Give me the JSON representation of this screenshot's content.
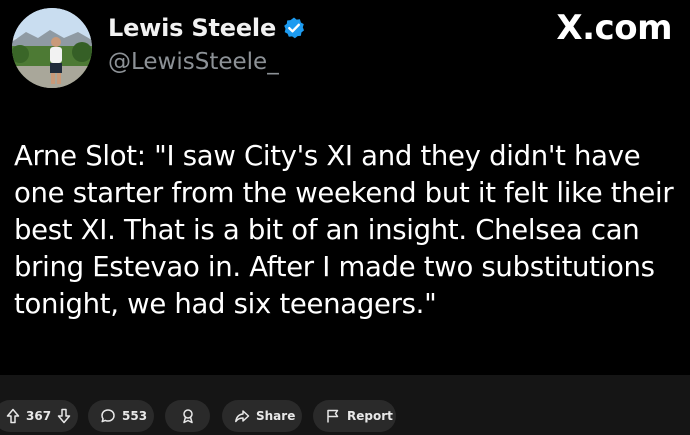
{
  "post": {
    "author_name": "Lewis Steele",
    "author_handle": "@LewisSteele_",
    "verified": true,
    "brand": "X.com",
    "text": "Arne Slot: \"I saw City's XI and they didn't have one starter from the weekend but it felt like their best XI. That is a bit of an insight. Chelsea can bring Estevao in. After I made two substitutions tonight, we had six teenagers.\""
  },
  "actions": {
    "vote_count": "367",
    "comment_count": "553",
    "share_label": "Share",
    "report_label": "Report"
  },
  "icons": {
    "verified": "verified-badge-icon",
    "upvote": "arrow-up-icon",
    "downvote": "arrow-down-icon",
    "comment": "speech-bubble-icon",
    "award": "award-icon",
    "share": "share-arrow-icon",
    "report": "flag-icon"
  },
  "colors": {
    "background": "#000000",
    "action_bar": "#151515",
    "pill": "#2a2a2a",
    "handle_gray": "#8c9196",
    "verified_blue": "#1d9bf0"
  }
}
